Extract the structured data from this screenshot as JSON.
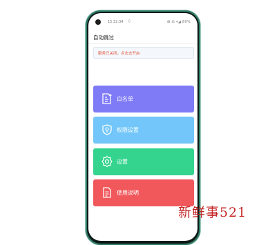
{
  "status_bar": {
    "time": "15:32:34",
    "bell": "♫",
    "right_icons": "⊞ ☊ ▾◢ 80%"
  },
  "header": {
    "title": "自动跳过"
  },
  "notice": {
    "text": "服务已关闭，点击去开启"
  },
  "menu": [
    {
      "label": "白名单",
      "icon": "whitelist-icon",
      "color": "#7f7bf6"
    },
    {
      "label": "权限设置",
      "icon": "shield-icon",
      "color": "#72c6f9"
    },
    {
      "label": "设置",
      "icon": "gear-icon",
      "color": "#35d48e"
    },
    {
      "label": "使用说明",
      "icon": "document-icon",
      "color": "#f0585c"
    }
  ],
  "watermark": {
    "text": "新鲜事521"
  }
}
